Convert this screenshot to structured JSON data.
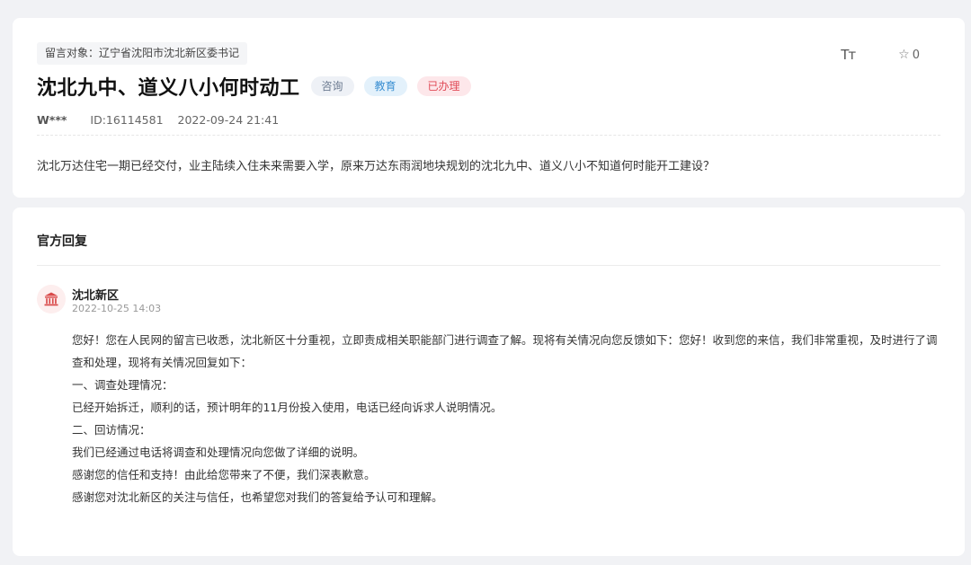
{
  "message": {
    "target": "留言对象：辽宁省沈阳市沈北新区委书记",
    "title": "沈北九中、道义八小何时动工",
    "tags": [
      "咨询",
      "教育",
      "已办理"
    ],
    "user": "W***",
    "id": "ID:16114581",
    "datetime": "2022-09-24 21:41",
    "content": "沈北万达住宅一期已经交付，业主陆续入住未来需要入学，原来万达东雨润地块规划的沈北九中、道义八小不知道何时能开工建设？"
  },
  "tools": {
    "font_size_label": "Tт",
    "favorite_count": "0"
  },
  "reply": {
    "heading": "官方回复",
    "org": "沈北新区",
    "time": "2022-10-25 14:03",
    "paragraphs": [
      "您好！您在人民网的留言已收悉，沈北新区十分重视，立即责成相关职能部门进行调查了解。现将有关情况向您反馈如下：您好！收到您的来信，我们非常重视，及时进行了调查和处理，现将有关情况回复如下：",
      "一、调查处理情况：",
      "已经开始拆迁，顺利的话，预计明年的11月份投入使用，电话已经向诉求人说明情况。",
      "二、回访情况：",
      "我们已经通过电话将调查和处理情况向您做了详细的说明。",
      "感谢您的信任和支持！由此给您带来了不便，我们深表歉意。",
      "感谢您对沈北新区的关注与信任，也希望您对我们的答复给予认可和理解。"
    ]
  },
  "icons": {
    "avatar": "government-building-icon",
    "favorite": "star-outline-icon",
    "font_size": "font-size-icon"
  }
}
